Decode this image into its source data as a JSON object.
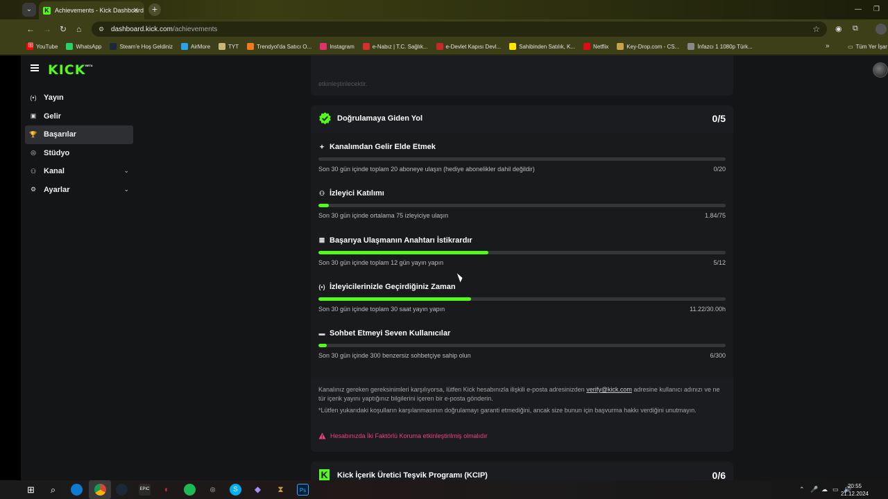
{
  "browser": {
    "tab_title": "Achievements - Kick Dashboard",
    "url_host": "dashboard.kick.com",
    "url_path": "/achievements",
    "bookmarks": [
      {
        "label": "YouTube",
        "color": "#ff0000"
      },
      {
        "label": "WhatsApp",
        "color": "#25d366"
      },
      {
        "label": "Steam'e Hoş Geldiniz",
        "color": "#1b2838"
      },
      {
        "label": "AirMore",
        "color": "#2aa3ef"
      },
      {
        "label": "TYT",
        "color": "#c9b57a"
      },
      {
        "label": "Trendyol'da Satıcı O...",
        "color": "#f27a1a"
      },
      {
        "label": "Instagram",
        "color": "#e1306c"
      },
      {
        "label": "e-Nabız | T.C. Sağlık...",
        "color": "#d32f2f"
      },
      {
        "label": "e-Devlet Kapısı Devl...",
        "color": "#c62828"
      },
      {
        "label": "Sahibinden Satılık, K...",
        "color": "#ffe800"
      },
      {
        "label": "Netflix",
        "color": "#e50914"
      },
      {
        "label": "Key-Drop.com - CS...",
        "color": "#c8a248"
      },
      {
        "label": "İnfazcı 1 1080p Türk...",
        "color": "#888888"
      }
    ],
    "other_bookmarks": "Tüm Yer İşar"
  },
  "sidebar": {
    "items": [
      {
        "label": "Yayın",
        "icon": "broadcast-icon",
        "glyph": "(•)"
      },
      {
        "label": "Gelir",
        "icon": "revenue-icon",
        "glyph": "▣"
      },
      {
        "label": "Başarılar",
        "icon": "trophy-icon",
        "glyph": "🏆"
      },
      {
        "label": "Stüdyo",
        "icon": "studio-icon",
        "glyph": "◎"
      },
      {
        "label": "Kanal",
        "icon": "channel-icon",
        "glyph": "⚇"
      },
      {
        "label": "Ayarlar",
        "icon": "settings-icon",
        "glyph": "⚙"
      }
    ]
  },
  "top_card": {
    "faded_text": "etkinleştirilecektir."
  },
  "verification": {
    "title": "Doğrulamaya Giden Yol",
    "score": "0/5",
    "requirements": [
      {
        "title": "Kanalımdan Gelir Elde Etmek",
        "desc": "Son 30 gün içinde toplam 20 aboneye ulaşın (hediye abonelikler dahil değildir)",
        "value": "0/20",
        "progress": 0.0,
        "glyph": "✦"
      },
      {
        "title": "İzleyici Katılımı",
        "desc": "Son 30 gün içinde ortalama 75 izleyiciye ulaşın",
        "value": "1.84/75",
        "progress": 0.025,
        "glyph": "⚇"
      },
      {
        "title": "Başarıya Ulaşmanın Anahtarı İstikrardır",
        "desc": "Son 30 gün içinde toplam 12 gün yayın yapın",
        "value": "5/12",
        "progress": 0.4167,
        "glyph": "▦"
      },
      {
        "title": "İzleyicilerinizle Geçirdiğiniz Zaman",
        "desc": "Son 30 gün içinde toplam 30 saat yayın yapın",
        "value": "11.22/30.00h",
        "progress": 0.374,
        "glyph": "(•)"
      },
      {
        "title": "Sohbet Etmeyi Seven Kullanıcılar",
        "desc": "Son 30 gün içinde 300 benzersiz sohbetçiye sahip olun",
        "value": "6/300",
        "progress": 0.02,
        "glyph": "▬"
      }
    ],
    "info_pre": "Kanalınız gereken gereksinimleri karşılıyorsa, lütfen Kick hesabınızla ilişkili e-posta adresinizden",
    "info_email": "verify@kick.com",
    "info_post": "adresine kullanıcı adınızı ve ne tür içerik yayını yaptığınız bilgilerini içeren bir e-posta gönderin.",
    "disclaimer": "*Lütfen yukarıdaki koşulların karşılanmasının doğrulamayı garanti etmediğini, ancak size bunun için başvurma hakkı verdiğini unutmayın.",
    "warning": "Hesabınızda İki Faktörlü Koruma etkinleştirilmiş olmalıdır"
  },
  "kcip": {
    "title": "Kick İçerik Üretici Teşvik Programı (KCIP)",
    "score": "0/6"
  },
  "clock": {
    "time": "20:55",
    "date": "21.12.2024"
  },
  "colors": {
    "accent": "#53fc18",
    "warning": "#f0437b"
  }
}
